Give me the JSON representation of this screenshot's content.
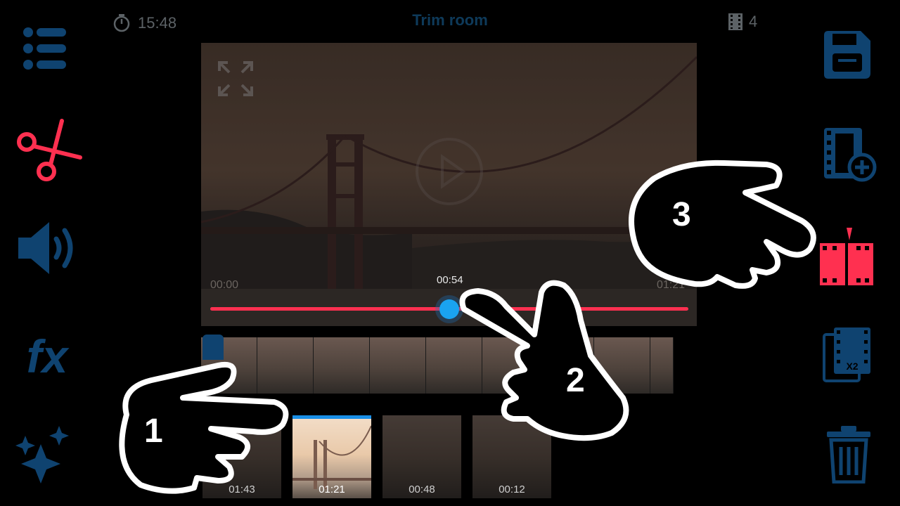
{
  "topbar": {
    "timer_icon": "stopwatch-icon",
    "timer_value": "15:48",
    "title": "Trim room",
    "clips_icon": "film-icon",
    "clips_count": "4"
  },
  "left_toolbar": [
    {
      "name": "menu",
      "icon": "menu-list-icon"
    },
    {
      "name": "trim",
      "icon": "scissors-icon",
      "active": true
    },
    {
      "name": "audio",
      "icon": "speaker-icon"
    },
    {
      "name": "effects",
      "icon": "fx-icon",
      "label": "fx"
    },
    {
      "name": "magic",
      "icon": "sparkles-icon"
    }
  ],
  "right_toolbar": [
    {
      "name": "save",
      "icon": "floppy-disk-icon"
    },
    {
      "name": "add-clip",
      "icon": "film-add-icon"
    },
    {
      "name": "split",
      "icon": "film-split-icon",
      "active": true
    },
    {
      "name": "duplicate",
      "icon": "film-duplicate-icon",
      "label": "X2"
    },
    {
      "name": "delete",
      "icon": "trash-icon"
    }
  ],
  "player": {
    "start_time": "00:00",
    "end_time": "01:21",
    "current_time": "00:54",
    "fullscreen_icon": "fullscreen-icon",
    "play_icon": "play-icon"
  },
  "clips": [
    {
      "duration": "01:43",
      "active": false
    },
    {
      "duration": "01:21",
      "active": true
    },
    {
      "duration": "00:48",
      "active": false
    },
    {
      "duration": "00:12",
      "active": false
    }
  ],
  "tutorial": {
    "step1": "1",
    "step2": "2",
    "step3": "3"
  },
  "colors": {
    "accent_red": "#ff3050",
    "accent_blue": "#1aa3f0",
    "icon_blue": "#0f4370"
  }
}
